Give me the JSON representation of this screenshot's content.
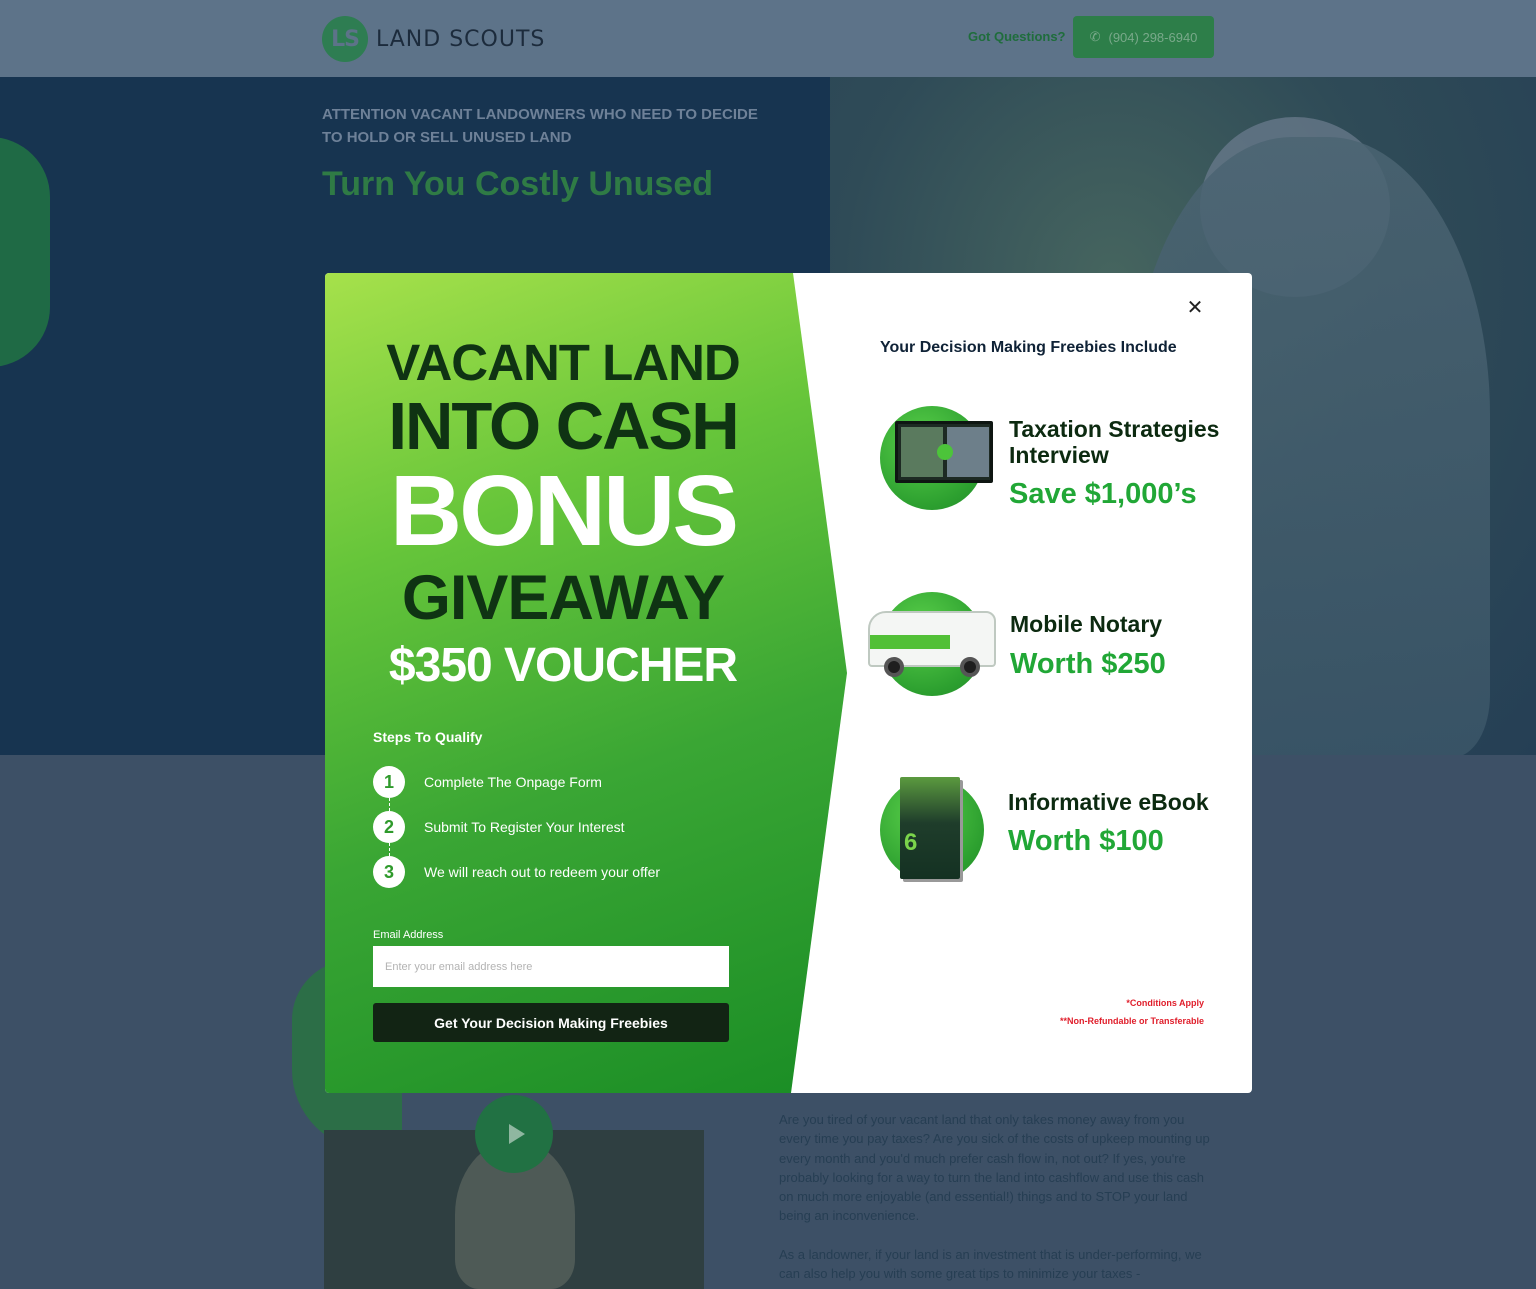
{
  "header": {
    "logo_mark": "LS",
    "logo_text": "LAND SCOUTS",
    "got_questions": "Got Questions?",
    "phone": "(904) 298-6940"
  },
  "hero": {
    "attention": "ATTENTION VACANT LANDOWNERS WHO NEED TO DECIDE TO HOLD OR SELL UNUSED LAND",
    "title_partial": "Turn You Costly Unused"
  },
  "content": {
    "paragraph1": "Are you tired of your vacant land that only takes money away from you every time you pay taxes? Are you sick of the costs of upkeep mounting up every month and you'd much prefer cash flow in, not out? If yes, you're probably looking for a way to turn the land into cashflow and use this cash on much more enjoyable (and essential!) things and to STOP your land being an inconvenience.",
    "paragraph2": "As a landowner, if your land is an investment that is under-performing, we can also help you with some great tips to minimize your taxes -"
  },
  "modal": {
    "headline": {
      "line1": "VACANT LAND",
      "line2": "INTO CASH",
      "line3": "BONUS",
      "line4": "GIVEAWAY",
      "line5": "$350 VOUCHER"
    },
    "steps_title": "Steps To Qualify",
    "steps": [
      {
        "num": "1",
        "text": "Complete The Onpage Form"
      },
      {
        "num": "2",
        "text": "Submit To Register Your Interest"
      },
      {
        "num": "3",
        "text": "We will reach out to redeem your offer"
      }
    ],
    "email_label": "Email Address",
    "email_placeholder": "Enter your email address here",
    "email_value": "",
    "submit_label": "Get Your Decision Making Freebies",
    "close_symbol": "✕",
    "freebies_title": "Your Decision Making Freebies Include",
    "freebies": [
      {
        "name": "Taxation Strategies Interview",
        "value": "Save $1,000’s",
        "icon": "video-interview-tv-icon"
      },
      {
        "name": "Mobile Notary",
        "value": "Worth $250",
        "icon": "notary-van-icon"
      },
      {
        "name": "Informative eBook",
        "value": "Worth $100",
        "icon": "ebook-icon"
      }
    ],
    "ebook_cover_number": "6",
    "conditions": [
      "*Conditions Apply",
      "**Non-Refundable or Transferable"
    ]
  },
  "colors": {
    "accent_green": "#21a736",
    "dark_button": "#122414",
    "condition_red": "#e01e2b",
    "overlay_navy": "#173450"
  }
}
